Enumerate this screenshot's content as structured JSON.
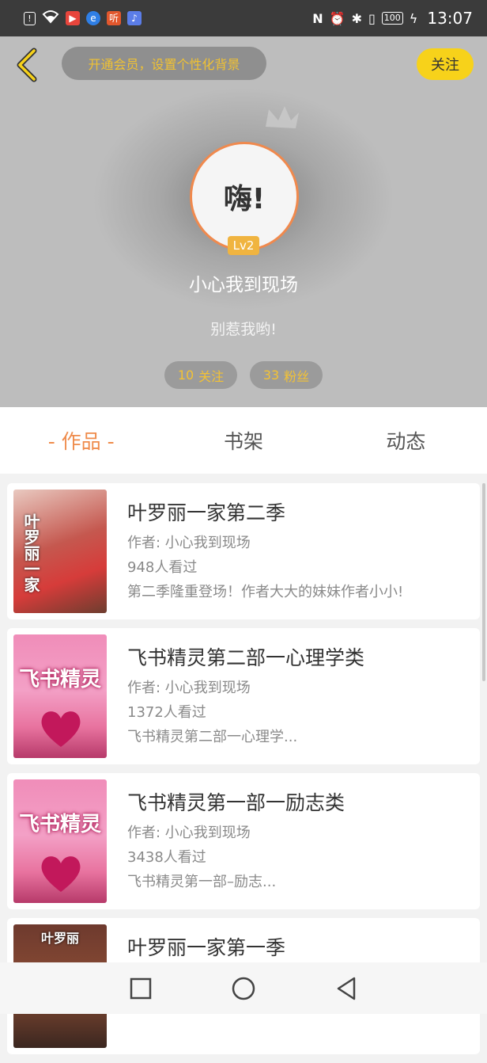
{
  "status_bar": {
    "time": "13:07",
    "battery": "100",
    "left_icons": [
      "notification-icon",
      "wifi-icon",
      "video-app-icon",
      "browser-app-icon",
      "listen-app-icon",
      "music-app-icon"
    ],
    "right_icons": [
      "nfc-icon",
      "alarm-icon",
      "bluetooth-icon",
      "vibrate-icon",
      "battery-icon",
      "charging-icon"
    ],
    "listen_app_char": "听"
  },
  "header": {
    "vip_prompt": "开通会员，设置个性化背景",
    "follow_label": "关注"
  },
  "profile": {
    "avatar_text": "嗨!",
    "level": "Lv2",
    "nickname": "小心我到现场",
    "bio": "别惹我哟!",
    "following_count": "10",
    "following_label": "关注",
    "fans_count": "33",
    "fans_label": "粉丝"
  },
  "tabs": [
    {
      "label": "- 作品 -",
      "active": true
    },
    {
      "label": "书架",
      "active": false
    },
    {
      "label": "动态",
      "active": false
    }
  ],
  "works": [
    {
      "title": "叶罗丽一家第二季",
      "author": "作者: 小心我到现场",
      "views": "948人看过",
      "desc": "第二季隆重登场！作者大大的妹妹作者小小!",
      "cover_text": "叶罗丽一家"
    },
    {
      "title": "飞书精灵第二部一心理学类",
      "author": "作者: 小心我到现场",
      "views": "1372人看过",
      "desc": "飞书精灵第二部一心理学...",
      "cover_text": "飞书精灵"
    },
    {
      "title": "飞书精灵第一部一励志类",
      "author": "作者: 小心我到现场",
      "views": "3438人看过",
      "desc": "飞书精灵第一部–励志...",
      "cover_text": "飞书精灵"
    },
    {
      "title": "叶罗丽一家第一季",
      "author": "",
      "views": "",
      "desc": "",
      "cover_text": "叶罗丽"
    }
  ],
  "colors": {
    "accent_orange": "#ef8b4b",
    "gold": "#f3c234",
    "follow_yellow": "#f7d21a"
  },
  "navbar": [
    "recents-square-icon",
    "home-circle-icon",
    "back-triangle-icon"
  ]
}
